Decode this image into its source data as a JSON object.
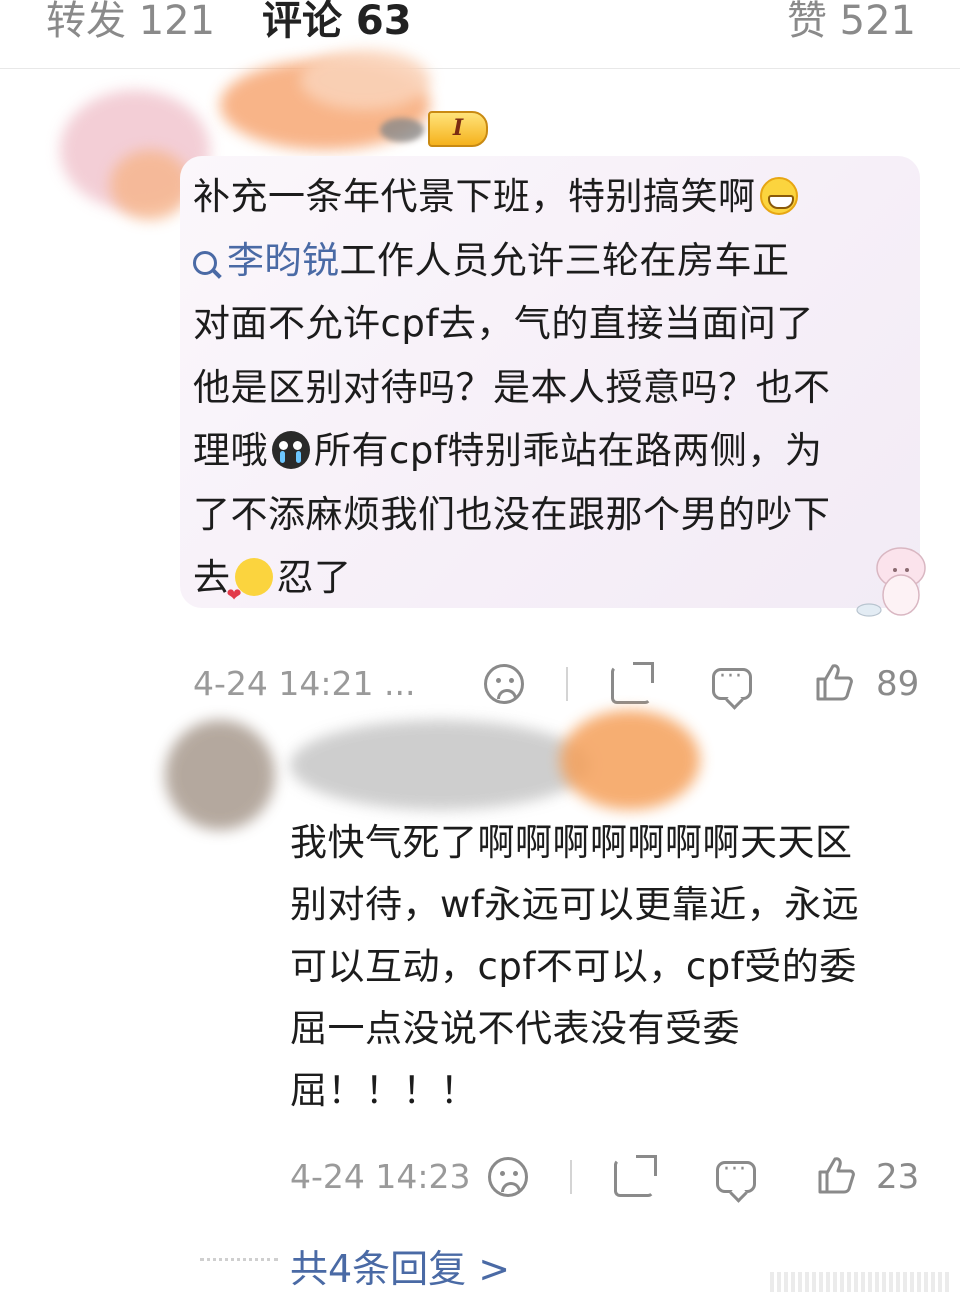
{
  "tabs": {
    "repost": "转发 121",
    "comment": "评论 63",
    "like": "赞 521"
  },
  "comment1": {
    "badge": "I",
    "line1": "补充一条年代景下班，特别搞笑啊",
    "topic": "李昀锐",
    "line2_rest": "工作人员允许三轮在房车正",
    "line3": "对面不允许cpf去，气的直接当面问了",
    "line4": "他是区别对待吗？是本人授意吗？也不",
    "line5_a": "理哦",
    "line5_b": "所有cpf特别乖站在路两侧，为",
    "line6": "了不添麻烦我们也没在跟那个男的吵下",
    "line7_a": "去",
    "line7_b": "忍了",
    "time": "4-24 14:21 ...",
    "likes": "89"
  },
  "comment2": {
    "line1": "我快气死了啊啊啊啊啊啊啊天天区",
    "line2": "别对待，wf永远可以更靠近，永远",
    "line3": "可以互动，cpf不可以，cpf受的委",
    "line4": "屈一点没说不代表没有受委",
    "line5": "屈！！！！",
    "time": "4-24 14:23",
    "likes": "23"
  },
  "replies": "共4条回复 >",
  "colors": {
    "link": "#4a6aa5",
    "bubble": "#f6eff8",
    "meta": "#9a9a9a"
  },
  "icons": [
    "search-icon",
    "grin-emoji-icon",
    "sob-emoji-icon",
    "kiss-emoji-icon",
    "dislike-face-icon",
    "share-icon",
    "comment-icon",
    "thumb-up-icon"
  ]
}
